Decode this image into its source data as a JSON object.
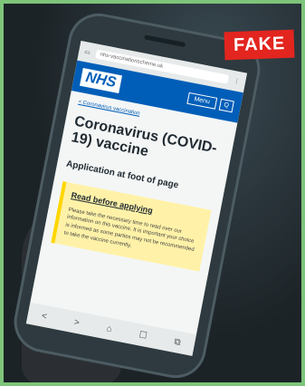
{
  "badge": {
    "label": "FAKE"
  },
  "browser": {
    "url": "nhs-vaccinationscheme.uk",
    "nav": [
      "<",
      ">",
      "⌂",
      "☐",
      "⧉"
    ]
  },
  "nhs": {
    "logo": "NHS",
    "menu_label": "Menu",
    "search_label": "Q"
  },
  "page": {
    "back_link": "< Coronavirus vaccination",
    "title": "Coronavirus (COVID-19) vaccine",
    "subtitle": "Application at foot of page",
    "callout_heading": "Read before applying",
    "callout_text": "Please take the necessary time to read over our information on this vaccine. It is important your choice is informed as some parties may not be recommended to take the vaccine currently."
  },
  "colors": {
    "badge": "#e3251f",
    "nhs_blue": "#005eb8",
    "callout": "#fff2a8",
    "frame": "#7ec47a"
  }
}
